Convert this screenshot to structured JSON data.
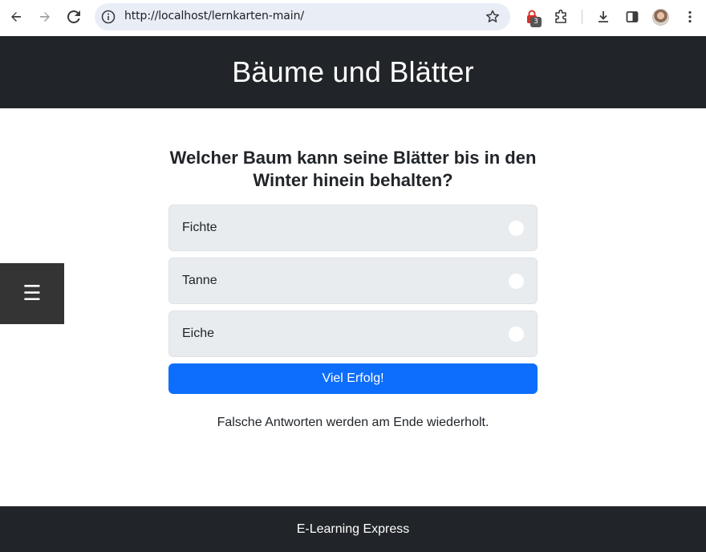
{
  "browser": {
    "url": "http://localhost/lernkarten-main/",
    "extension_badge_count": "3",
    "icons": {
      "back": "arrow-left-icon",
      "forward": "arrow-right-icon",
      "reload": "reload-icon",
      "info": "info-icon",
      "bookmark": "star-icon",
      "extension": "extension-icon",
      "puzzle": "puzzle-icon",
      "download": "download-icon",
      "sidepanel": "side-panel-icon",
      "menu": "more-vertical-icon"
    }
  },
  "header": {
    "title": "Bäume und Blätter"
  },
  "menu_toggle": {
    "glyph": "☰"
  },
  "quiz": {
    "question": "Welcher Baum kann seine Blätter bis in den Winter hinein behalten?",
    "options": [
      {
        "label": "Fichte"
      },
      {
        "label": "Tanne"
      },
      {
        "label": "Eiche"
      }
    ],
    "submit_label": "Viel Erfolg!",
    "hint": "Falsche Antworten werden am Ende wiederholt."
  },
  "footer": {
    "text": "E-Learning Express"
  },
  "colors": {
    "header_bg": "#212529",
    "option_bg": "#e9ecef",
    "button_primary": "#0d6efd",
    "menu_toggle_bg": "#343434"
  }
}
